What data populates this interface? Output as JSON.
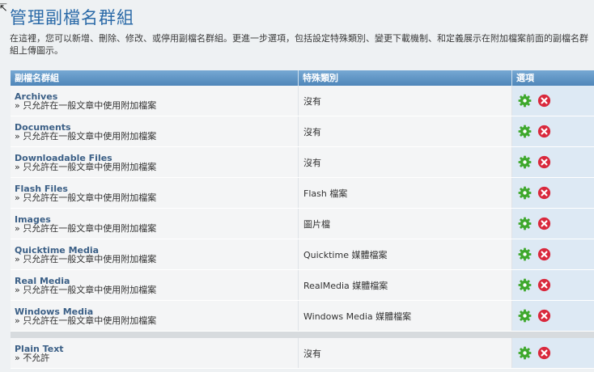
{
  "page": {
    "title": "管理副檔名群組",
    "description": "在這裡，您可以新增、刪除、修改、或停用副檔名群組。更進一步選項，包括設定特殊類別、變更下載機制、和定義展示在附加檔案前面的副檔名群組上傳圖示。"
  },
  "table": {
    "headers": {
      "name": "副檔名群組",
      "category": "特殊類別",
      "options": "選項"
    },
    "rows": [
      {
        "name": "Archives",
        "status": "» 只允許在一般文章中使用附加檔案",
        "category": "沒有"
      },
      {
        "name": "Documents",
        "status": "» 只允許在一般文章中使用附加檔案",
        "category": "沒有"
      },
      {
        "name": "Downloadable Files",
        "status": "» 只允許在一般文章中使用附加檔案",
        "category": "沒有"
      },
      {
        "name": "Flash Files",
        "status": "» 只允許在一般文章中使用附加檔案",
        "category": "Flash 檔案"
      },
      {
        "name": "Images",
        "status": "» 只允許在一般文章中使用附加檔案",
        "category": "圖片檔"
      },
      {
        "name": "Quicktime Media",
        "status": "» 只允許在一般文章中使用附加檔案",
        "category": "Quicktime 媒體檔案"
      },
      {
        "name": "Real Media",
        "status": "» 只允許在一般文章中使用附加檔案",
        "category": "RealMedia 媒體檔案"
      },
      {
        "name": "Windows Media",
        "status": "» 只允許在一般文章中使用附加檔案",
        "category": "Windows Media 媒體檔案"
      }
    ],
    "disabled_rows": [
      {
        "name": "Plain Text",
        "status": "» 不允許",
        "category": "沒有"
      }
    ]
  },
  "icons": {
    "edit": "gear-icon",
    "delete": "delete-x-icon"
  },
  "colors": {
    "title": "#2b6aa8",
    "header_bg": "#5b93c4",
    "options_bg": "#dde9f4",
    "gear": "#3ea82c",
    "delete": "#d9283c"
  }
}
